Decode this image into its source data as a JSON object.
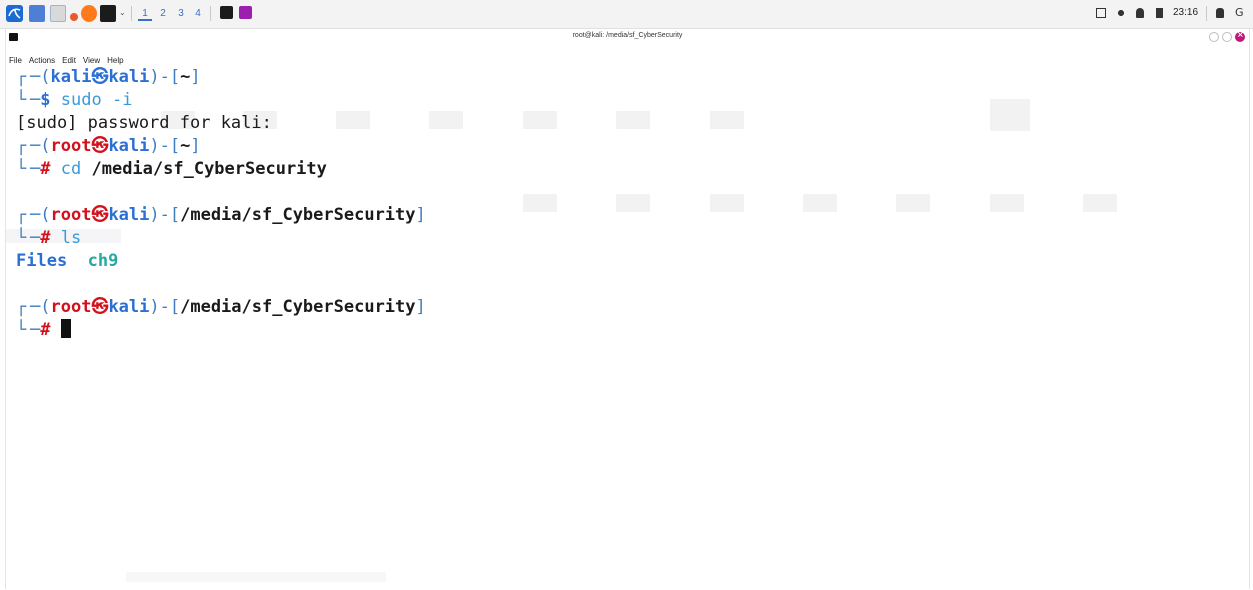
{
  "panel": {
    "workspaces": [
      "1",
      "2",
      "3",
      "4"
    ],
    "active_workspace": "1",
    "clock": "23:16"
  },
  "window": {
    "title": "root@kali: /media/sf_CyberSecurity"
  },
  "menu": {
    "items": [
      "File",
      "Actions",
      "Edit",
      "View",
      "Help"
    ]
  },
  "terminal": {
    "prompt1": {
      "user": "kali",
      "at_symbol": "㉿",
      "host": "kali",
      "path": "~",
      "symbol": "$",
      "command": "sudo",
      "arg": "-i"
    },
    "output1": "[sudo] password for kali:",
    "prompt2": {
      "user": "root",
      "at_symbol": "㉿",
      "host": "kali",
      "path": "~",
      "symbol": "#",
      "command": "cd",
      "arg": "/media/sf_CyberSecurity"
    },
    "prompt3": {
      "user": "root",
      "at_symbol": "㉿",
      "host": "kali",
      "path": "/media/sf_CyberSecurity",
      "symbol": "#",
      "command": "ls"
    },
    "ls_output": [
      "Files",
      "ch9"
    ],
    "prompt4": {
      "user": "root",
      "at_symbol": "㉿",
      "host": "kali",
      "path": "/media/sf_CyberSecurity",
      "symbol": "#"
    }
  },
  "colors": {
    "panel_bg": "#f3f3f3",
    "kali_blue": "#2a6fd6",
    "root_red": "#d3111d",
    "dir_cyan": "#26a8a0"
  }
}
